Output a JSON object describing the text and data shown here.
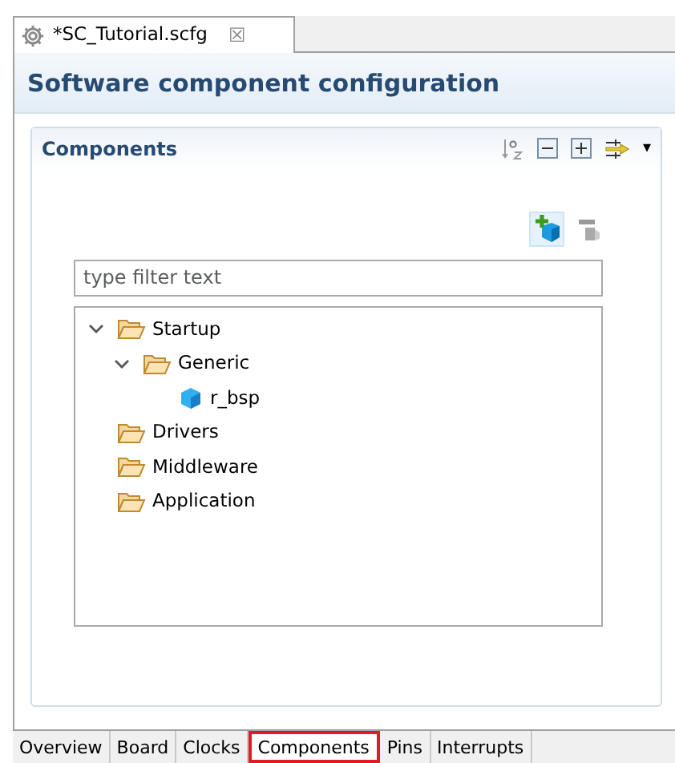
{
  "editor_tab": {
    "title": "*SC_Tutorial.scfg",
    "close": "☒"
  },
  "header": {
    "title": "Software component configuration"
  },
  "section": {
    "title": "Components",
    "menu_caret": "▾"
  },
  "filter": {
    "placeholder": "type filter text"
  },
  "tree": [
    {
      "label": "Startup",
      "kind": "folder",
      "expanded": true,
      "children": [
        {
          "label": "Generic",
          "kind": "folder",
          "expanded": true,
          "children": [
            {
              "label": "r_bsp",
              "kind": "component"
            }
          ]
        }
      ]
    },
    {
      "label": "Drivers",
      "kind": "folder",
      "expanded": false
    },
    {
      "label": "Middleware",
      "kind": "folder",
      "expanded": false
    },
    {
      "label": "Application",
      "kind": "folder",
      "expanded": false
    }
  ],
  "bottom_tabs": [
    {
      "label": "Overview",
      "selected": false
    },
    {
      "label": "Board",
      "selected": false
    },
    {
      "label": "Clocks",
      "selected": false
    },
    {
      "label": "Components",
      "selected": true
    },
    {
      "label": "Pins",
      "selected": false
    },
    {
      "label": "Interrupts",
      "selected": false
    }
  ]
}
